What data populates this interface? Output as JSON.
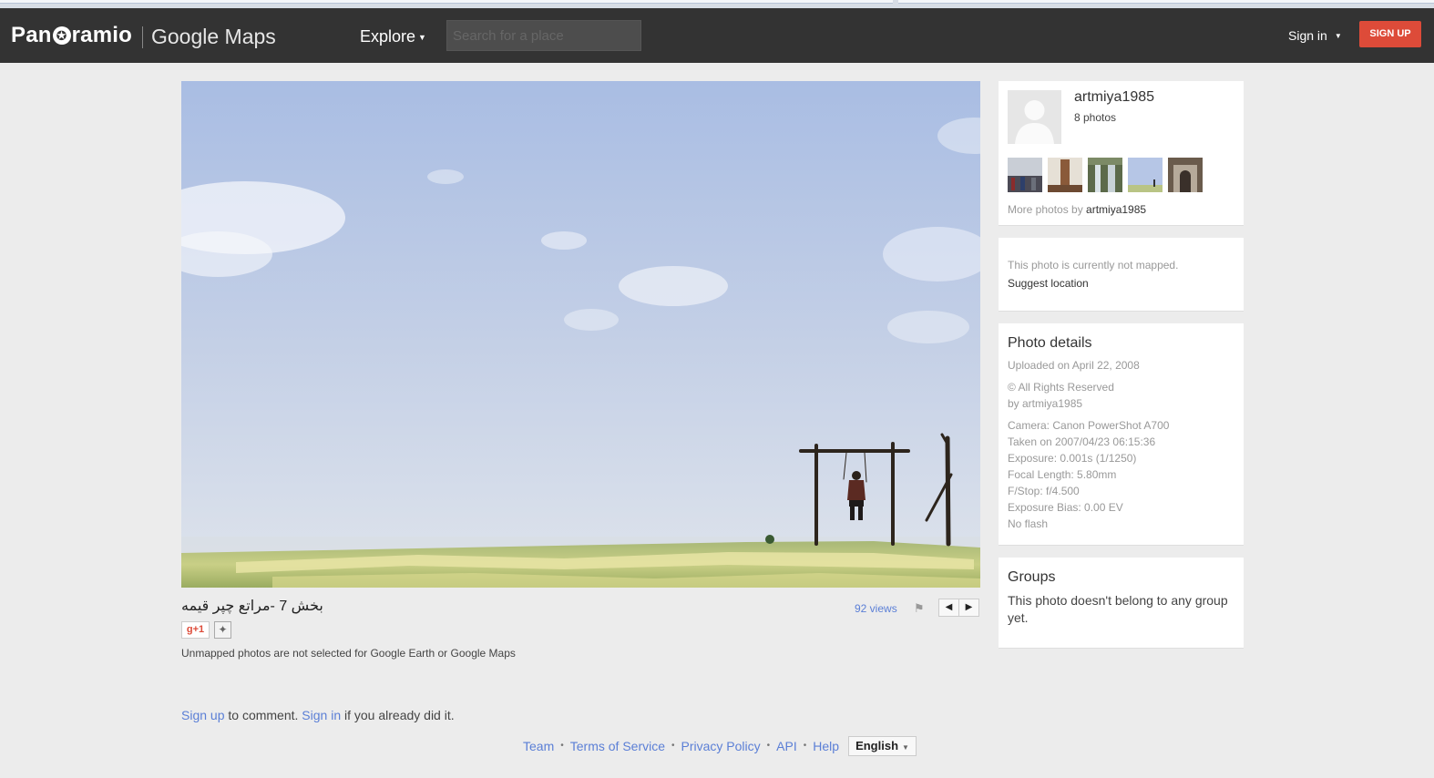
{
  "navbar": {
    "logo_text_a": "Pan",
    "logo_star": "✪",
    "logo_text_b": "ramio",
    "gmaps_text": "Google Maps",
    "explore_label": "Explore",
    "search_placeholder": "Search for a place",
    "signin_label": "Sign in",
    "signup_label": "SIGN UP"
  },
  "photo": {
    "title": "بخش 7 -مراتع چپر قیمه",
    "gplus_label": "g+1",
    "unmapped_note": "Unmapped photos are not selected for Google Earth or Google Maps",
    "views": "92 views",
    "prev_label": "◀",
    "next_label": "▶"
  },
  "comments": {
    "signup_link": "Sign up",
    "text_a": " to comment. ",
    "signin_link": "Sign in",
    "text_b": " if you already did it."
  },
  "footer": {
    "links": [
      "Team",
      "Terms of Service",
      "Privacy Policy",
      "API",
      "Help"
    ],
    "language": "English"
  },
  "author_card": {
    "username": "artmiya1985",
    "photo_count": "8 photos",
    "more_photos_prefix": "More photos by ",
    "more_photos_user": "artmiya1985"
  },
  "map_card": {
    "not_mapped": "This photo is currently not mapped.",
    "suggest": "Suggest location"
  },
  "details_card": {
    "heading": "Photo details",
    "uploaded": "Uploaded on April 22, 2008",
    "rights": "© All Rights Reserved",
    "by": "by artmiya1985",
    "camera": "Camera: Canon PowerShot A700",
    "taken": "Taken on 2007/04/23 06:15:36",
    "exposure": "Exposure: 0.001s (1/1250)",
    "focal": "Focal Length: 5.80mm",
    "fstop": "F/Stop: f/4.500",
    "bias": "Exposure Bias: 0.00 EV",
    "flash": "No flash"
  },
  "groups_card": {
    "heading": "Groups",
    "text": "This photo doesn't belong to any group yet."
  },
  "colors": {
    "navbar": "#333333",
    "signup": "#dd4b39",
    "link": "#5b7fd6",
    "page_bg": "#ececec"
  }
}
